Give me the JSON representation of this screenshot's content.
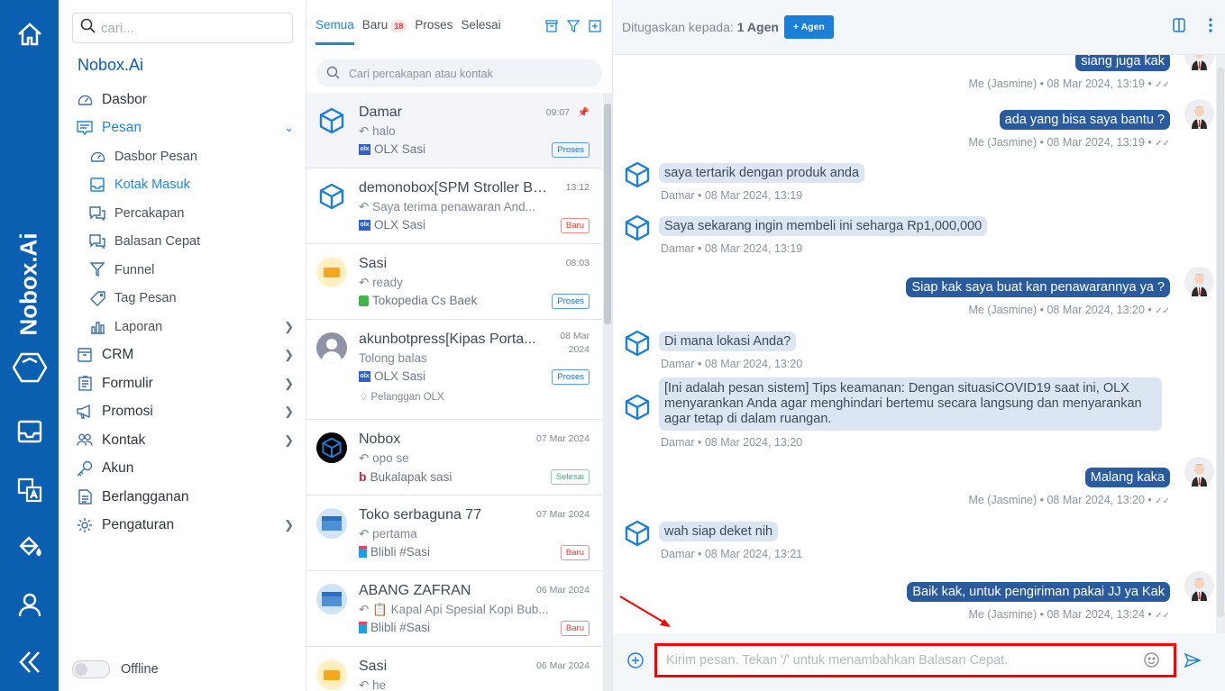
{
  "rail": {
    "brand": "Nobox.Ai",
    "icons": [
      "home-icon",
      "logo-icon",
      "inbox-icon",
      "translate-icon",
      "paint-bucket-icon",
      "user-icon",
      "collapse-icon"
    ]
  },
  "sidebar": {
    "search_placeholder": "cari...",
    "org": "Nobox.Ai",
    "items": [
      {
        "label": "Dasbor",
        "icon": "dashboard-icon"
      },
      {
        "label": "Pesan",
        "icon": "message-icon",
        "active": true,
        "expanded": true
      },
      {
        "label": "Dasbor Pesan",
        "icon": "dashboard-icon",
        "sub": true
      },
      {
        "label": "Kotak Masuk",
        "icon": "inbox-icon",
        "sub": true,
        "active": true
      },
      {
        "label": "Percakapan",
        "icon": "chat-icon",
        "sub": true
      },
      {
        "label": "Balasan Cepat",
        "icon": "chat-icon",
        "sub": true
      },
      {
        "label": "Funnel",
        "icon": "funnel-icon",
        "sub": true
      },
      {
        "label": "Tag Pesan",
        "icon": "tag-icon",
        "sub": true
      },
      {
        "label": "Laporan",
        "icon": "chart-icon",
        "sub": true,
        "arrow": true
      },
      {
        "label": "CRM",
        "icon": "box-icon",
        "arrow": true
      },
      {
        "label": "Formulir",
        "icon": "clipboard-icon",
        "arrow": true
      },
      {
        "label": "Promosi",
        "icon": "megaphone-icon",
        "arrow": true
      },
      {
        "label": "Kontak",
        "icon": "users-icon",
        "arrow": true
      },
      {
        "label": "Akun",
        "icon": "key-icon"
      },
      {
        "label": "Berlangganan",
        "icon": "document-icon"
      },
      {
        "label": "Pengaturan",
        "icon": "gear-icon",
        "arrow": true
      }
    ],
    "status": "Offline"
  },
  "list": {
    "tabs": [
      {
        "label": "Semua"
      },
      {
        "label": "Baru",
        "badge": "18"
      },
      {
        "label": "Proses"
      },
      {
        "label": "Selesai"
      }
    ],
    "search_placeholder": "Cari percakapan atau kontak",
    "conversations": [
      {
        "name": "Damar",
        "time": "09:07",
        "preview": "halo",
        "channel": "OLX Sasi",
        "status": "Proses"
      },
      {
        "name": "demonobox[SPM Stroller Ba...",
        "time": "13:12",
        "preview": "Saya terima penawaran And...",
        "channel": "OLX Sasi",
        "status": "Baru"
      },
      {
        "name": "Sasi",
        "time": "08:03",
        "preview": "ready",
        "channel": "Tokopedia Cs Baek",
        "status": "Proses"
      },
      {
        "name": "akunbotpress[Kipas Porta...",
        "time": "08 Mar 2024",
        "preview": "Tolong balas",
        "channel": "OLX Sasi",
        "status": "Proses",
        "tag": "Pelanggan OLX"
      },
      {
        "name": "Nobox",
        "time": "07 Mar 2024",
        "preview": "opo se",
        "channel": "Bukalapak sasi",
        "status": "Selesai"
      },
      {
        "name": "Toko serbaguna 77",
        "time": "07 Mar 2024",
        "preview": "pertama",
        "channel": "Blibli #Sasi",
        "status": "Baru"
      },
      {
        "name": "ABANG ZAFRAN",
        "time": "06 Mar 2024",
        "preview": "📋 Kapal Api Spesial Kopi Bub...",
        "channel": "Blibli #Sasi",
        "status": "Baru"
      },
      {
        "name": "Sasi",
        "time": "06 Mar 2024",
        "preview": "he"
      }
    ]
  },
  "chat": {
    "assigned_label": "Ditugaskan kepada:",
    "assigned_value": "1 Agen",
    "add_agent": "+ Agen",
    "messages": [
      {
        "dir": "out",
        "text": "siang juga kak",
        "meta": "Me (Jasmine) • 08 Mar 2024, 13:19 •"
      },
      {
        "dir": "out",
        "text": "ada yang bisa saya bantu ?",
        "meta": "Me (Jasmine) • 08 Mar 2024, 13:19 •"
      },
      {
        "dir": "in",
        "text": "saya tertarik dengan produk anda",
        "meta": "Damar • 08 Mar 2024, 13:19"
      },
      {
        "dir": "in",
        "text": "Saya sekarang ingin membeli ini seharga Rp1,000,000",
        "meta": "Damar • 08 Mar 2024, 13:19"
      },
      {
        "dir": "out",
        "text": "Siap kak saya buat kan penawarannya ya ?",
        "meta": "Me (Jasmine) • 08 Mar 2024, 13:20 •"
      },
      {
        "dir": "in",
        "text": "Di mana lokasi Anda?",
        "meta": "Damar • 08 Mar 2024, 13:20"
      },
      {
        "dir": "in",
        "text": "[Ini adalah pesan sistem] Tips keamanan: Dengan situasiCOVID19 saat ini, OLX menyarankan Anda agar menghindari bertemu secara langsung dan menyarankan agar tetap di dalam ruangan.",
        "meta": "Damar • 08 Mar 2024, 13:20"
      },
      {
        "dir": "out",
        "text": "Malang kaka",
        "meta": "Me (Jasmine) • 08 Mar 2024, 13:20 •"
      },
      {
        "dir": "in",
        "text": "wah siap deket nih",
        "meta": "Damar • 08 Mar 2024, 13:21"
      },
      {
        "dir": "out",
        "text": "Baik kak, untuk pengiriman pakai JJ ya Kak",
        "meta": "Me (Jasmine) • 08 Mar 2024, 13:24 •"
      }
    ],
    "input_placeholder": "Kirim pesan. Tekan '/' untuk menambahkan Balasan Cepat."
  },
  "colors": {
    "brand": "#0b5fb0",
    "accent": "#1a86e0",
    "outgoing": "#2a5b9f",
    "incoming": "#dce5f2",
    "highlight": "#ff0000"
  }
}
